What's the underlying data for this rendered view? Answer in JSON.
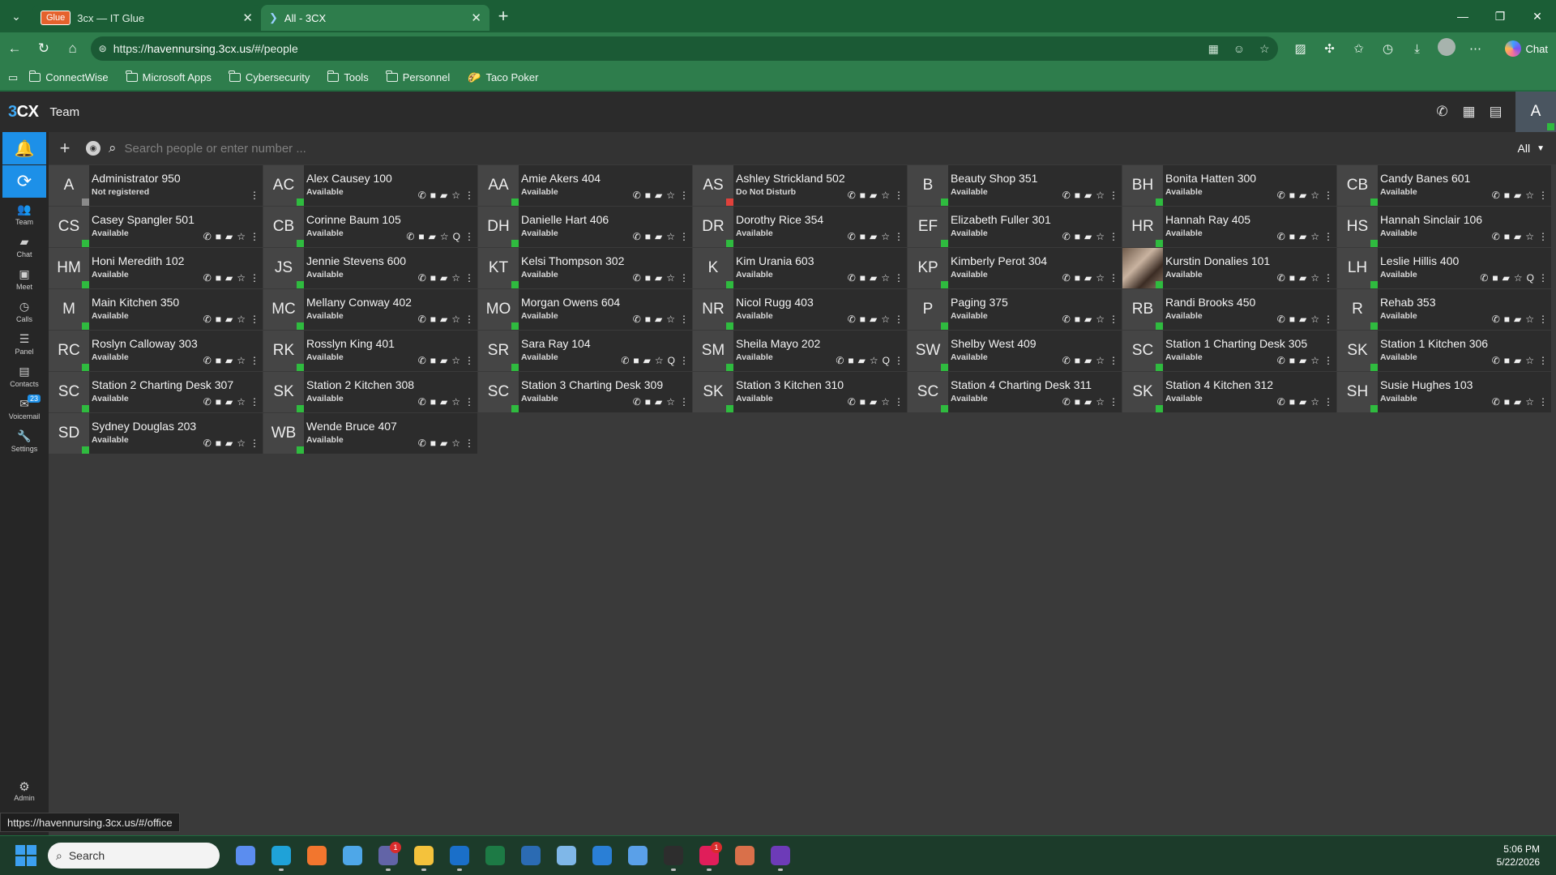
{
  "browser": {
    "tabs": [
      {
        "badge": "Glue",
        "title": "3cx — IT Glue",
        "active": false
      },
      {
        "title": "All - 3CX",
        "active": true
      }
    ],
    "url_prefix": "https://",
    "url_host": "havennursing.3cx.us",
    "url_path": "/#/people",
    "chat_label": "Chat",
    "bookmarks": [
      "ConnectWise",
      "Microsoft Apps",
      "Cybersecurity",
      "Tools",
      "Personnel",
      "Taco Poker"
    ]
  },
  "app": {
    "logo": "3CX",
    "title": "Team",
    "user_initial": "A",
    "search_placeholder": "Search people or enter number ...",
    "filter_label": "All",
    "sidebar": [
      {
        "label": "Team"
      },
      {
        "label": "Chat"
      },
      {
        "label": "Meet"
      },
      {
        "label": "Calls"
      },
      {
        "label": "Panel"
      },
      {
        "label": "Contacts"
      },
      {
        "label": "Voicemail",
        "badge": "23"
      },
      {
        "label": "Settings"
      }
    ],
    "admin_label": "Admin"
  },
  "people": [
    {
      "initials": "A",
      "name": "Administrator 950",
      "status": "Not registered",
      "state": "none"
    },
    {
      "initials": "AC",
      "name": "Alex Causey 100",
      "status": "Available",
      "state": "ok"
    },
    {
      "initials": "AA",
      "name": "Amie Akers 404",
      "status": "Available",
      "state": "ok"
    },
    {
      "initials": "AS",
      "name": "Ashley Strickland 502",
      "status": "Do Not Disturb",
      "state": "dnd"
    },
    {
      "initials": "B",
      "name": "Beauty Shop 351",
      "status": "Available",
      "state": "ok"
    },
    {
      "initials": "BH",
      "name": "Bonita Hatten 300",
      "status": "Available",
      "state": "ok"
    },
    {
      "initials": "CB",
      "name": "Candy Banes 601",
      "status": "Available",
      "state": "ok"
    },
    {
      "initials": "CS",
      "name": "Casey Spangler 501",
      "status": "Available",
      "state": "ok"
    },
    {
      "initials": "CB",
      "name": "Corinne Baum 105",
      "status": "Available",
      "state": "ok",
      "queue": "Q"
    },
    {
      "initials": "DH",
      "name": "Danielle Hart 406",
      "status": "Available",
      "state": "ok"
    },
    {
      "initials": "DR",
      "name": "Dorothy Rice 354",
      "status": "Available",
      "state": "ok"
    },
    {
      "initials": "EF",
      "name": "Elizabeth Fuller 301",
      "status": "Available",
      "state": "ok"
    },
    {
      "initials": "HR",
      "name": "Hannah Ray 405",
      "status": "Available",
      "state": "ok"
    },
    {
      "initials": "HS",
      "name": "Hannah Sinclair 106",
      "status": "Available",
      "state": "ok"
    },
    {
      "initials": "HM",
      "name": "Honi Meredith 102",
      "status": "Available",
      "state": "ok"
    },
    {
      "initials": "JS",
      "name": "Jennie Stevens 600",
      "status": "Available",
      "state": "ok"
    },
    {
      "initials": "KT",
      "name": "Kelsi Thompson 302",
      "status": "Available",
      "state": "ok"
    },
    {
      "initials": "K",
      "name": "Kim Urania 603",
      "status": "Available",
      "state": "ok"
    },
    {
      "initials": "KP",
      "name": "Kimberly Perot 304",
      "status": "Available",
      "state": "ok"
    },
    {
      "initials": "",
      "name": "Kurstin Donalies 101",
      "status": "Available",
      "state": "ok",
      "photo": true
    },
    {
      "initials": "LH",
      "name": "Leslie Hillis 400",
      "status": "Available",
      "state": "ok",
      "queue": "Q"
    },
    {
      "initials": "M",
      "name": "Main Kitchen 350",
      "status": "Available",
      "state": "ok"
    },
    {
      "initials": "MC",
      "name": "Mellany Conway 402",
      "status": "Available",
      "state": "ok"
    },
    {
      "initials": "MO",
      "name": "Morgan Owens 604",
      "status": "Available",
      "state": "ok"
    },
    {
      "initials": "NR",
      "name": "Nicol Rugg 403",
      "status": "Available",
      "state": "ok"
    },
    {
      "initials": "P",
      "name": "Paging 375",
      "status": "Available",
      "state": "ok"
    },
    {
      "initials": "RB",
      "name": "Randi Brooks 450",
      "status": "Available",
      "state": "ok"
    },
    {
      "initials": "R",
      "name": "Rehab 353",
      "status": "Available",
      "state": "ok"
    },
    {
      "initials": "RC",
      "name": "Roslyn Calloway 303",
      "status": "Available",
      "state": "ok"
    },
    {
      "initials": "RK",
      "name": "Rosslyn King 401",
      "status": "Available",
      "state": "ok"
    },
    {
      "initials": "SR",
      "name": "Sara Ray 104",
      "status": "Available",
      "state": "ok",
      "queue": "Q"
    },
    {
      "initials": "SM",
      "name": "Sheila Mayo 202",
      "status": "Available",
      "state": "ok",
      "queue": "Q"
    },
    {
      "initials": "SW",
      "name": "Shelby West 409",
      "status": "Available",
      "state": "ok"
    },
    {
      "initials": "SC",
      "name": "Station 1 Charting Desk 305",
      "status": "Available",
      "state": "ok"
    },
    {
      "initials": "SK",
      "name": "Station 1 Kitchen 306",
      "status": "Available",
      "state": "ok"
    },
    {
      "initials": "SC",
      "name": "Station 2 Charting Desk 307",
      "status": "Available",
      "state": "ok"
    },
    {
      "initials": "SK",
      "name": "Station 2 Kitchen 308",
      "status": "Available",
      "state": "ok"
    },
    {
      "initials": "SC",
      "name": "Station 3 Charting Desk 309",
      "status": "Available",
      "state": "ok"
    },
    {
      "initials": "SK",
      "name": "Station 3 Kitchen 310",
      "status": "Available",
      "state": "ok"
    },
    {
      "initials": "SC",
      "name": "Station 4 Charting Desk 311",
      "status": "Available",
      "state": "ok"
    },
    {
      "initials": "SK",
      "name": "Station 4 Kitchen 312",
      "status": "Available",
      "state": "ok"
    },
    {
      "initials": "SH",
      "name": "Susie Hughes 103",
      "status": "Available",
      "state": "ok"
    },
    {
      "initials": "SD",
      "name": "Sydney Douglas 203",
      "status": "Available",
      "state": "ok"
    },
    {
      "initials": "WB",
      "name": "Wende Bruce 407",
      "status": "Available",
      "state": "ok"
    }
  ],
  "status_bar_url": "https://havennursing.3cx.us/#/office",
  "taskbar": {
    "search_label": "Search",
    "time": "5:06 PM",
    "date": "5/22/2026",
    "apps": [
      {
        "name": "m365-app",
        "color": "#5b8def"
      },
      {
        "name": "edge-app",
        "color": "#1fa2d8",
        "running": true
      },
      {
        "name": "firefox-app",
        "color": "#f2762e"
      },
      {
        "name": "notepad-app",
        "color": "#4ea7e8"
      },
      {
        "name": "teams-app",
        "color": "#6264a7",
        "badge": "1",
        "running": true
      },
      {
        "name": "file-explorer-app",
        "color": "#f4c23c",
        "running": true
      },
      {
        "name": "outlook-app",
        "color": "#1a6fc9",
        "running": true
      },
      {
        "name": "excel-app",
        "color": "#1d7a45"
      },
      {
        "name": "powershell-app",
        "color": "#2b6bb3"
      },
      {
        "name": "network-app",
        "color": "#7fb7e8"
      },
      {
        "name": "azure-app",
        "color": "#2a7fd6"
      },
      {
        "name": "remote-desktop-app",
        "color": "#5aa0e8"
      },
      {
        "name": "terminal-app",
        "color": "#2d2d2d",
        "running": true
      },
      {
        "name": "slack-app",
        "color": "#e01e5a",
        "badge": "1",
        "running": true
      },
      {
        "name": "claude-app",
        "color": "#d9704a"
      },
      {
        "name": "screenconnect-app",
        "color": "#6d3bb8",
        "running": true
      }
    ]
  }
}
